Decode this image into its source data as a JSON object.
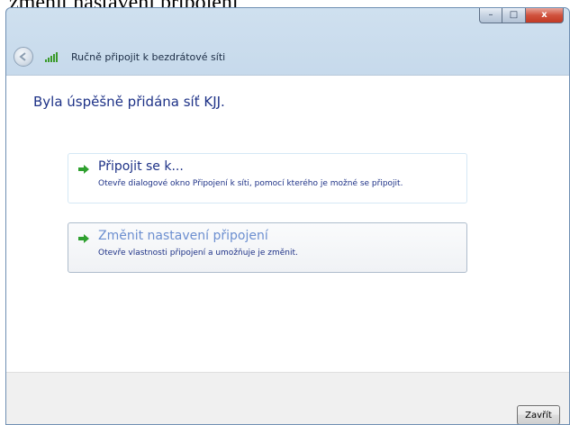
{
  "document": {
    "caption": "změnit nastavení připojení"
  },
  "window": {
    "controls": {
      "minimize": "–",
      "maximize": "□",
      "close": "x"
    }
  },
  "nav": {
    "title": "Ručně připojit k bezdrátové síti"
  },
  "content": {
    "heading": "Byla úspěšně přidána síť KJJ.",
    "commands": [
      {
        "title": "Připojit se k...",
        "description": "Otevře dialogové okno Připojení k síti, pomocí kterého je možné se připojit."
      },
      {
        "title": "Změnit nastavení připojení",
        "description": "Otevře vlastnosti připojení a umožňuje je změnit."
      }
    ]
  },
  "footer": {
    "close_label": "Zavřít"
  },
  "colors": {
    "link": "#1e3287",
    "link_hover": "#6c8fd0",
    "arrow": "#2fa02f"
  }
}
